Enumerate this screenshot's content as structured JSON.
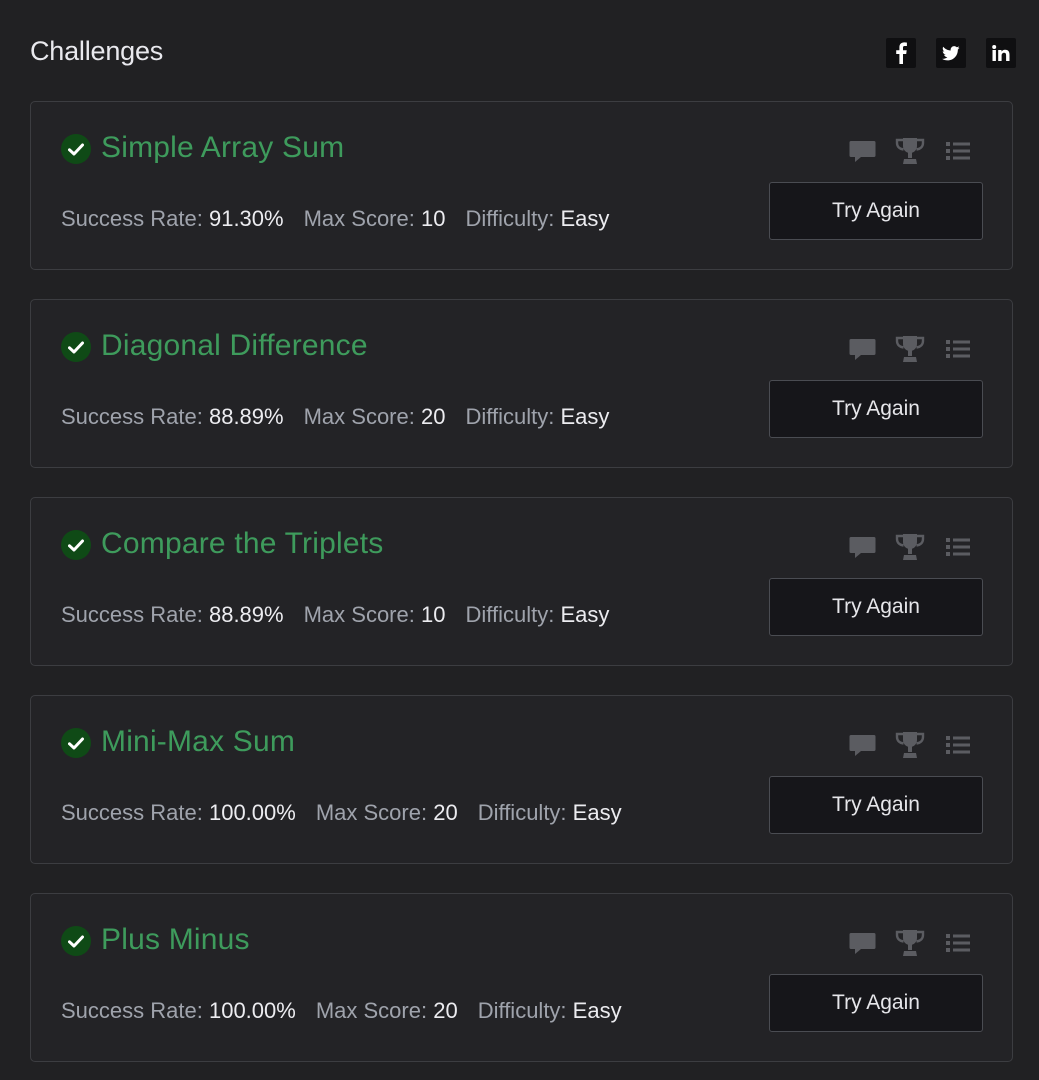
{
  "header": {
    "title": "Challenges",
    "social": [
      "facebook-icon",
      "twitter-icon",
      "linkedin-icon"
    ]
  },
  "colors": {
    "background": "#212123",
    "card_border": "#3c3d41",
    "title_green": "#3e9b5c",
    "check_bg": "#0f4a16",
    "label_gray": "#9fa3ac",
    "value_white": "#ececf0",
    "button_bg": "#16161a",
    "icon_gray": "#5b5c61"
  },
  "labels": {
    "success_rate": "Success Rate:",
    "max_score": "Max Score:",
    "difficulty": "Difficulty:"
  },
  "challenges": [
    {
      "title": "Simple Array Sum",
      "success_rate": "91.30%",
      "max_score": "10",
      "difficulty": "Easy",
      "button": "Try Again"
    },
    {
      "title": "Diagonal Difference",
      "success_rate": "88.89%",
      "max_score": "20",
      "difficulty": "Easy",
      "button": "Try Again"
    },
    {
      "title": "Compare the Triplets",
      "success_rate": "88.89%",
      "max_score": "10",
      "difficulty": "Easy",
      "button": "Try Again"
    },
    {
      "title": "Mini-Max Sum",
      "success_rate": "100.00%",
      "max_score": "20",
      "difficulty": "Easy",
      "button": "Try Again"
    },
    {
      "title": "Plus Minus",
      "success_rate": "100.00%",
      "max_score": "20",
      "difficulty": "Easy",
      "button": "Try Again"
    }
  ]
}
